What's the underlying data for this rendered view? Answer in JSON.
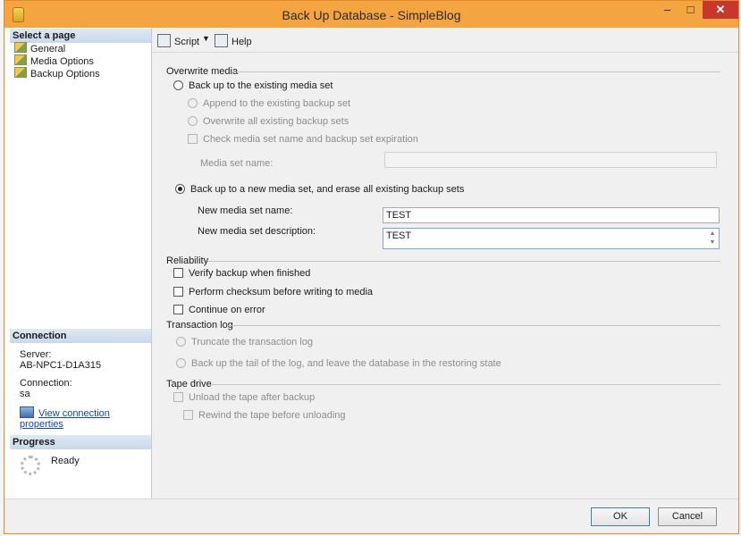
{
  "window": {
    "title": "Back Up Database - SimpleBlog",
    "min_glyph": "–",
    "max_glyph": "□",
    "close_glyph": "✕"
  },
  "left": {
    "select_page_header": "Select a page",
    "pages": [
      {
        "label": "General"
      },
      {
        "label": "Media Options"
      },
      {
        "label": "Backup Options"
      }
    ],
    "connection_header": "Connection",
    "server_label": "Server:",
    "server_value": "AB-NPC1-D1A315",
    "connection_label": "Connection:",
    "connection_value": "sa",
    "view_connection_link": "View connection properties",
    "progress_header": "Progress",
    "progress_status": "Ready"
  },
  "toolbar": {
    "script_label": "Script",
    "dropdown_glyph": "▼",
    "help_label": "Help"
  },
  "overwrite_media": {
    "label": "Overwrite media",
    "existing_set": "Back up to the existing media set",
    "append": "Append to the existing backup set",
    "overwrite": "Overwrite all existing backup sets",
    "check_expiration": "Check media set name and backup set expiration",
    "media_set_name_label": "Media set name:",
    "media_set_name_value": "",
    "new_media_set": "Back up to a new media set, and erase all existing backup sets",
    "new_name_label": "New media set name:",
    "new_name_value": "TEST",
    "new_desc_label": "New media set description:",
    "new_desc_value": "TEST"
  },
  "reliability": {
    "label": "Reliability",
    "verify": "Verify backup when finished",
    "checksum": "Perform checksum before writing to media",
    "continue_on_error": "Continue on error"
  },
  "transaction_log": {
    "label": "Transaction log",
    "truncate": "Truncate the transaction log",
    "tail": "Back up the tail of the log, and leave the database in the restoring state"
  },
  "tape_drive": {
    "label": "Tape drive",
    "unload": "Unload the tape after backup",
    "rewind": "Rewind the tape before unloading"
  },
  "footer": {
    "ok_label": "OK",
    "cancel_label": "Cancel"
  }
}
